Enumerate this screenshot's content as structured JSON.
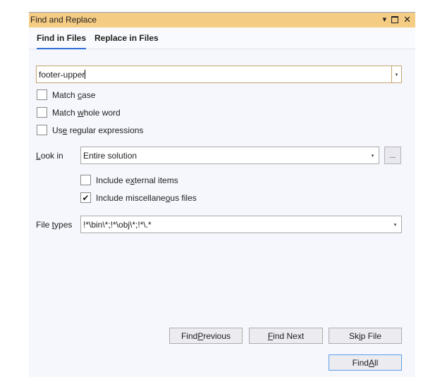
{
  "window": {
    "title": "Find and Replace",
    "icons": {
      "dropdown": "▾",
      "maximize": "maximize-icon",
      "close": "✕"
    }
  },
  "tabs": [
    {
      "label": "Find in Files",
      "active": true
    },
    {
      "label": "Replace in Files",
      "active": false
    }
  ],
  "find": {
    "value": "footer-upper",
    "dropdown_glyph": "▾"
  },
  "options": {
    "match_case": {
      "pre": "Match ",
      "key": "c",
      "post": "ase",
      "checked": false
    },
    "match_whole_word": {
      "pre": "Match ",
      "key": "w",
      "post": "hole word",
      "checked": false
    },
    "use_regex": {
      "pre": "Us",
      "key": "e",
      "post": " regular expressions",
      "checked": false
    }
  },
  "look_in": {
    "label_key": "L",
    "label_rest": "ook in",
    "value": "Entire solution",
    "dropdown_glyph": "▾",
    "browse_label": "..."
  },
  "include": {
    "external": {
      "pre": "Include e",
      "key": "x",
      "post": "ternal items",
      "checked": false
    },
    "misc": {
      "pre": "Include miscellane",
      "key": "o",
      "post": "us files",
      "checked": true,
      "check_glyph": "✔"
    }
  },
  "file_types": {
    "label_pre": "File ",
    "label_key": "t",
    "label_post": "ypes",
    "value": "!*\\bin\\*;!*\\obj\\*;!*\\.*",
    "dropdown_glyph": "▾"
  },
  "buttons": {
    "find_previous": {
      "pre": "Find ",
      "key": "P",
      "post": "revious"
    },
    "find_next": {
      "pre": "",
      "key": "F",
      "post": "ind Next"
    },
    "skip_file": {
      "pre": "Sk",
      "key": "i",
      "post": "p File"
    },
    "find_all": {
      "pre": "Find ",
      "key": "A",
      "post": "ll"
    }
  }
}
